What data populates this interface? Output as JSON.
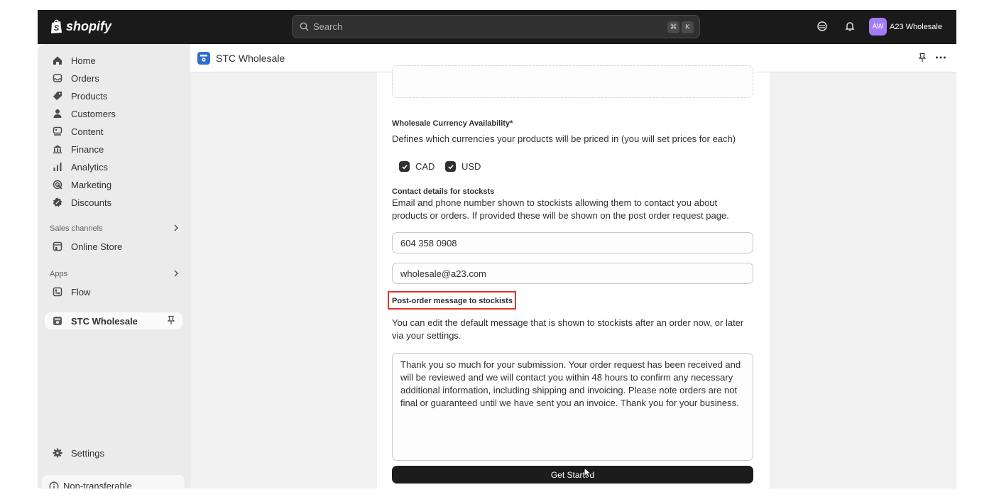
{
  "topbar": {
    "logo_text": "shopify",
    "search_placeholder": "Search",
    "shortcut_cmd": "⌘",
    "shortcut_key": "K",
    "store_initials": "AW",
    "store_name": "A23 Wholesale",
    "avatar_color": "#a47cf6"
  },
  "sidebar": {
    "items": [
      {
        "label": "Home",
        "icon": "home-icon"
      },
      {
        "label": "Orders",
        "icon": "inbox-icon"
      },
      {
        "label": "Products",
        "icon": "tag-icon"
      },
      {
        "label": "Customers",
        "icon": "person-icon"
      },
      {
        "label": "Content",
        "icon": "content-icon"
      },
      {
        "label": "Finance",
        "icon": "bank-icon"
      },
      {
        "label": "Analytics",
        "icon": "bar-chart-icon"
      },
      {
        "label": "Marketing",
        "icon": "target-icon"
      },
      {
        "label": "Discounts",
        "icon": "discount-icon"
      }
    ],
    "sales_channels_label": "Sales channels",
    "online_store_label": "Online Store",
    "apps_label": "Apps",
    "flow_label": "Flow",
    "active_app_label": "STC Wholesale",
    "settings_label": "Settings",
    "nontransferable_label": "Non-transferable"
  },
  "app": {
    "title": "STC Wholesale",
    "icon_text": "STC"
  },
  "form": {
    "currency_label": "Wholesale Currency Availability*",
    "currency_help": "Defines which currencies your products will be priced in (you will set prices for each)",
    "currencies": [
      {
        "label": "CAD",
        "checked": true
      },
      {
        "label": "USD",
        "checked": true
      }
    ],
    "contact_label": "Contact details for stocksts",
    "contact_help": "Email and phone number shown to stockists allowing them to contact you about products or orders. If provided these will be shown on the post order request page.",
    "phone_value": "604 358 0908",
    "email_value": "wholesale@a23.com",
    "post_order_label": "Post-order message to stockists",
    "post_order_help": "You can edit the default message that is shown to stockists after an order now, or later via your settings.",
    "post_order_message": "Thank you so much for your submission. Your order request has been received and will be reviewed and we will contact you within 48 hours to confirm any necessary additional information, including shipping and invoicing. Please note orders are not final or guaranteed until we have sent you an invoice. Thank you for your business.",
    "submit_label": "Get Started"
  },
  "colors": {
    "highlight": "#e0352c",
    "topbar": "#1a1a1a",
    "button": "#1c1c1c"
  }
}
